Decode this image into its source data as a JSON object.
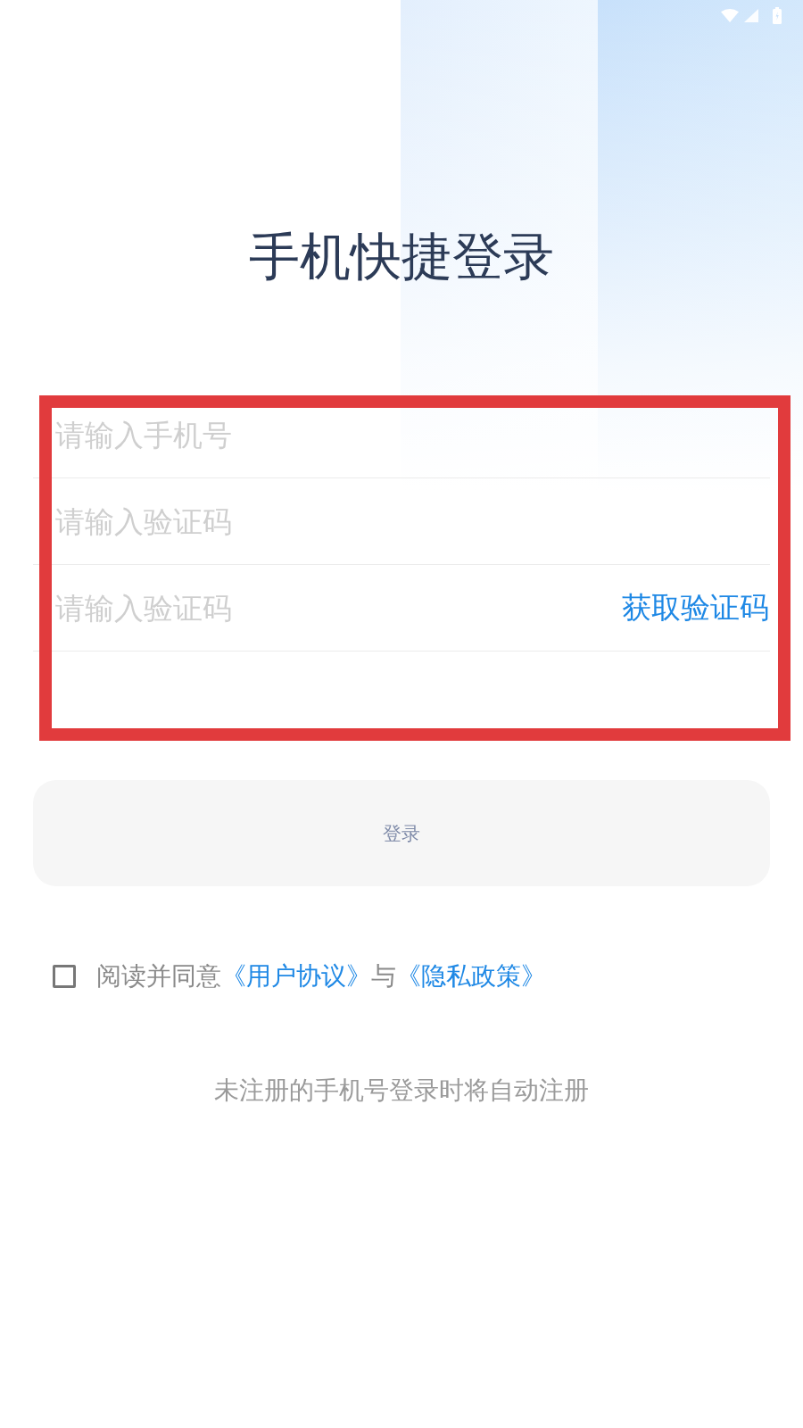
{
  "title": "手机快捷登录",
  "form": {
    "highlighted": true,
    "fields": [
      {
        "placeholder": "请输入手机号"
      },
      {
        "placeholder": "请输入验证码"
      },
      {
        "placeholder": "请输入验证码",
        "action": "获取验证码"
      }
    ]
  },
  "login_button": {
    "label": "登录",
    "disabled": true
  },
  "agreement": {
    "checked": false,
    "parts": [
      {
        "kind": "text",
        "text": "阅读并同意"
      },
      {
        "kind": "link",
        "text": "《用户协议》"
      },
      {
        "kind": "text",
        "text": "与"
      },
      {
        "kind": "link",
        "text": "《隐私政策》"
      }
    ]
  },
  "note": "未注册的手机号登录时将自动注册"
}
